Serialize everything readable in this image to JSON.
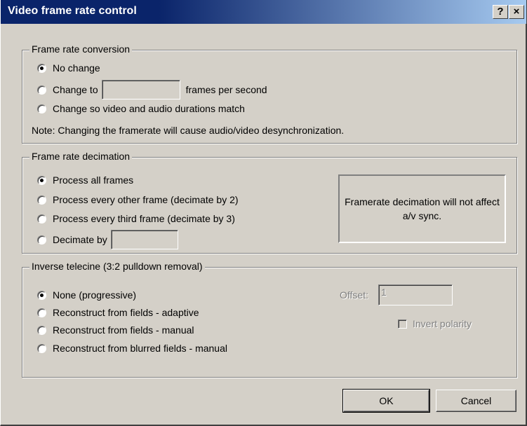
{
  "window": {
    "title": "Video frame rate control",
    "help_glyph": "?",
    "close_glyph": "×"
  },
  "frame_rate_conversion": {
    "title": "Frame rate conversion",
    "options": [
      {
        "label": "No change",
        "checked": true
      },
      {
        "label": "Change to",
        "checked": false
      },
      {
        "label": "Change so video and audio durations match",
        "checked": false
      }
    ],
    "change_to_value": "",
    "change_to_suffix": "frames per second",
    "note": "Note: Changing the framerate will cause audio/video desynchronization."
  },
  "frame_rate_decimation": {
    "title": "Frame rate decimation",
    "options": [
      {
        "label": "Process all frames",
        "checked": true
      },
      {
        "label": "Process every other frame (decimate by 2)",
        "checked": false
      },
      {
        "label": "Process every third frame (decimate by 3)",
        "checked": false
      },
      {
        "label": "Decimate by",
        "checked": false
      }
    ],
    "decimate_by_value": "",
    "info": "Framerate decimation will not affect a/v sync."
  },
  "inverse_telecine": {
    "title": "Inverse telecine (3:2 pulldown removal)",
    "options": [
      {
        "label": "None (progressive)",
        "checked": true
      },
      {
        "label": "Reconstruct from fields - adaptive",
        "checked": false
      },
      {
        "label": "Reconstruct from fields - manual",
        "checked": false
      },
      {
        "label": "Reconstruct from blurred fields - manual",
        "checked": false
      }
    ],
    "offset_label": "Offset:",
    "offset_value": "1",
    "invert_polarity_label": "Invert polarity",
    "invert_polarity_checked": false
  },
  "buttons": {
    "ok": "OK",
    "cancel": "Cancel"
  }
}
